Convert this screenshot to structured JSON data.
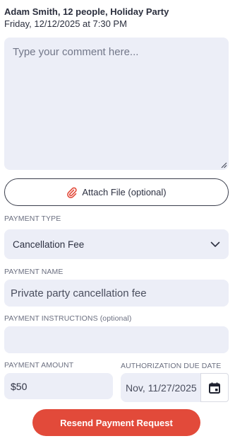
{
  "header": {
    "summary": "Adam Smith, 12 people, Holiday Party",
    "datetime": "Friday, 12/12/2025 at 7:30 PM"
  },
  "comment": {
    "placeholder": "Type your comment here...",
    "value": ""
  },
  "attach": {
    "label": "Attach File (optional)",
    "icon": "paperclip-icon",
    "icon_color": "#e24a3a"
  },
  "payment_type": {
    "label": "PAYMENT TYPE",
    "selected": "Cancellation Fee"
  },
  "payment_name": {
    "label": "PAYMENT NAME",
    "value": "Private party cancellation fee"
  },
  "payment_instructions": {
    "label": "PAYMENT INSTRUCTIONS (optional)",
    "value": ""
  },
  "payment_amount": {
    "label": "PAYMENT AMOUNT",
    "value": "$50"
  },
  "due_date": {
    "label": "AUTHORIZATION DUE DATE",
    "value": "Nov, 11/27/2025",
    "icon": "calendar-icon"
  },
  "actions": {
    "resend_label": "Resend Payment Request",
    "accent": "#e24a3a"
  }
}
